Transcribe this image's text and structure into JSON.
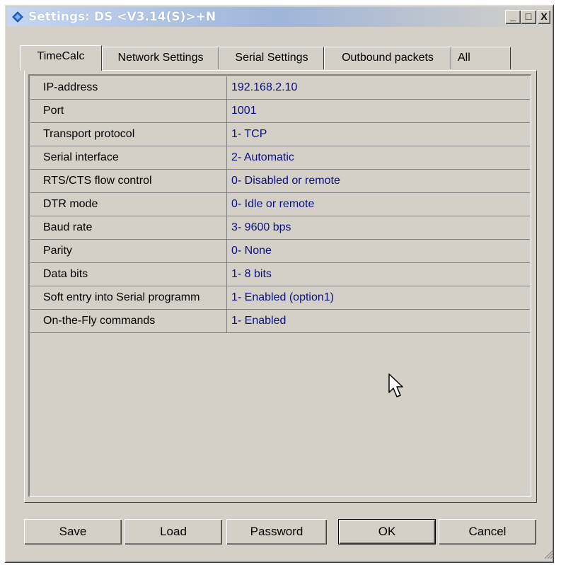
{
  "window": {
    "title": "Settings: DS <V3.14(S)>+N",
    "controls": {
      "minimize": "_",
      "maximize": "□",
      "close": "X"
    }
  },
  "tabs": [
    {
      "label": "TimeCalc",
      "active": true
    },
    {
      "label": "Network Settings",
      "active": false
    },
    {
      "label": "Serial Settings",
      "active": false
    },
    {
      "label": "Outbound packets",
      "active": false
    },
    {
      "label": "All",
      "active": false
    }
  ],
  "settings": [
    {
      "name": "IP-address",
      "value": "192.168.2.10"
    },
    {
      "name": "Port",
      "value": "1001"
    },
    {
      "name": "Transport protocol",
      "value": "1- TCP"
    },
    {
      "name": "Serial interface",
      "value": "2- Automatic"
    },
    {
      "name": "RTS/CTS flow control",
      "value": "0- Disabled or remote"
    },
    {
      "name": "DTR mode",
      "value": "0- Idle or remote"
    },
    {
      "name": "Baud rate",
      "value": "3- 9600 bps"
    },
    {
      "name": "Parity",
      "value": "0- None"
    },
    {
      "name": "Data bits",
      "value": "1- 8 bits"
    },
    {
      "name": "Soft entry into Serial programm",
      "value": "1- Enabled (option1)"
    },
    {
      "name": "On-the-Fly commands",
      "value": "1- Enabled"
    }
  ],
  "buttons": {
    "save": "Save",
    "load": "Load",
    "password": "Password",
    "ok": "OK",
    "cancel": "Cancel"
  },
  "colors": {
    "face": "#d4d0c8",
    "value_text": "#0a1080",
    "title_gradient_start": "#c6d6f0"
  }
}
